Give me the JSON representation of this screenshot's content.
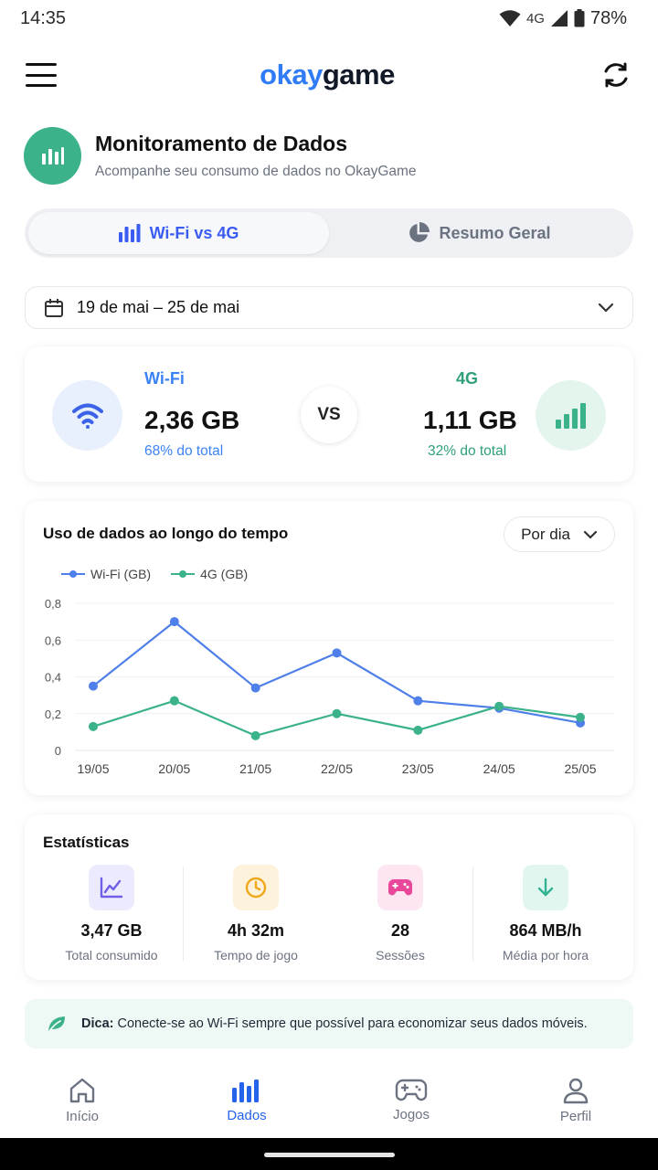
{
  "status_bar": {
    "time": "14:35",
    "network": "4G",
    "battery": "78%"
  },
  "app": {
    "logo_part1": "okay",
    "logo_part2": "game"
  },
  "header": {
    "title": "Monitoramento de Dados",
    "subtitle": "Acompanhe seu consumo de dados no OkayGame"
  },
  "tabs": [
    {
      "label": "Wi-Fi vs 4G",
      "active": true
    },
    {
      "label": "Resumo Geral",
      "active": false
    }
  ],
  "date_range": "19 de mai – 25 de mai",
  "compare": {
    "wifi": {
      "name": "Wi-Fi",
      "value": "2,36 GB",
      "pct": "68% do total"
    },
    "vs": "VS",
    "g4": {
      "name": "4G",
      "value": "1,11 GB",
      "pct": "32% do total"
    }
  },
  "chart_section": {
    "title": "Uso de dados ao longo do tempo",
    "period": "Por dia"
  },
  "chart_data": {
    "type": "line",
    "x": [
      "19/05",
      "20/05",
      "21/05",
      "22/05",
      "23/05",
      "24/05",
      "25/05"
    ],
    "series": [
      {
        "name": "Wi-Fi (GB)",
        "color": "#4f7fe8",
        "values": [
          0.35,
          0.7,
          0.34,
          0.53,
          0.27,
          0.23,
          0.15
        ]
      },
      {
        "name": "4G (GB)",
        "color": "#3bb28a",
        "values": [
          0.13,
          0.27,
          0.08,
          0.2,
          0.11,
          0.24,
          0.18
        ]
      }
    ],
    "ylim": [
      0,
      0.8
    ],
    "yticks": [
      "0",
      "0,2",
      "0,4",
      "0,6",
      "0,8"
    ],
    "grid": true,
    "legend": "top-left"
  },
  "stats": {
    "title": "Estatísticas",
    "items": [
      {
        "value": "3,47 GB",
        "label": "Total consumido",
        "icon": "trend-icon",
        "color": "#6d5fe6",
        "bg": "#eceafd"
      },
      {
        "value": "4h 32m",
        "label": "Tempo de jogo",
        "icon": "clock-icon",
        "color": "#f0a81a",
        "bg": "#fdf2dc"
      },
      {
        "value": "28",
        "label": "Sessões",
        "icon": "gamepad-icon",
        "color": "#e8479a",
        "bg": "#fde6f1"
      },
      {
        "value": "864 MB/h",
        "label": "Média por hora",
        "icon": "download-icon",
        "color": "#2fb392",
        "bg": "#e2f6f0"
      }
    ]
  },
  "tip": {
    "label": "Dica:",
    "text": "Conecte-se ao Wi-Fi sempre que possível para economizar seus dados móveis."
  },
  "nav": [
    {
      "label": "Início",
      "icon": "home-icon",
      "active": false
    },
    {
      "label": "Dados",
      "icon": "chart-icon",
      "active": true
    },
    {
      "label": "Jogos",
      "icon": "gamepad-icon",
      "active": false
    },
    {
      "label": "Perfil",
      "icon": "user-icon",
      "active": false
    }
  ]
}
